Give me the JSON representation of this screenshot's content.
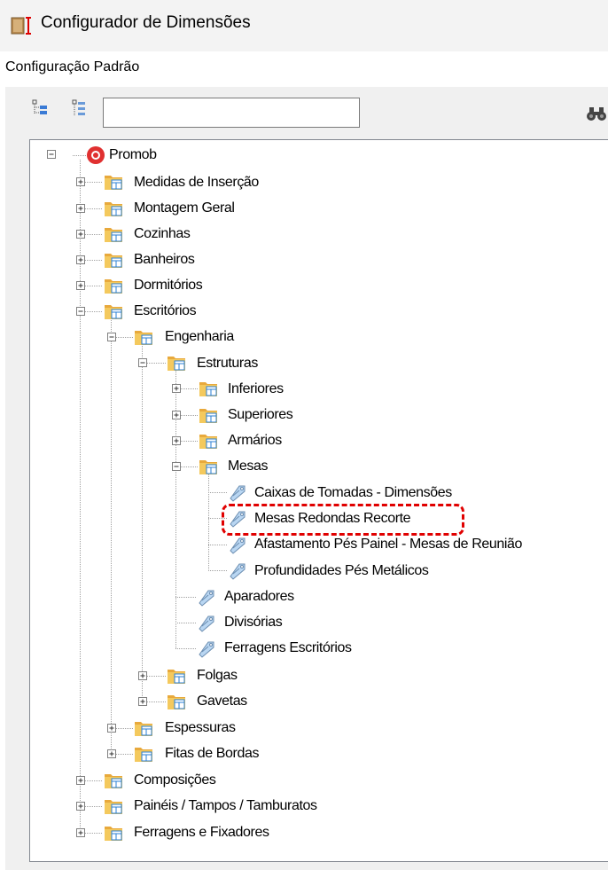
{
  "window": {
    "title": "Configurador de Dimensões",
    "icon": "dimensions-app-icon"
  },
  "section": {
    "label": "Configuração Padrão"
  },
  "toolbar": {
    "search_value": "",
    "buttons": [
      "expand-tree-icon",
      "collapse-tree-icon",
      "binoculars-find-icon"
    ]
  },
  "colors": {
    "highlight": "#e00000",
    "folder": "#e8a93c",
    "tag": "#9ec3e6",
    "root": "#e03030"
  },
  "tree": {
    "root": "Promob",
    "nodes": {
      "medidas_insercao": "Medidas de Inserção",
      "montagem_geral": "Montagem Geral",
      "cozinhas": "Cozinhas",
      "banheiros": "Banheiros",
      "dormitorios": "Dormitórios",
      "escritorios": "Escritórios",
      "engenharia": "Engenharia",
      "estruturas": "Estruturas",
      "inferiores": "Inferiores",
      "superiores": "Superiores",
      "armarios": "Armários",
      "mesas": "Mesas",
      "caixas_tomadas": "Caixas de Tomadas - Dimensões",
      "mesas_redondas": "Mesas Redondas Recorte",
      "afastamento": "Afastamento Pés Painel - Mesas de Reunião",
      "profundidades": "Profundidades Pés Metálicos",
      "aparadores": "Aparadores",
      "divisorias": "Divisórias",
      "ferragens_escritorios": "Ferragens Escritórios",
      "folgas": "Folgas",
      "gavetas": "Gavetas",
      "espessuras": "Espessuras",
      "fitas_bordas": "Fitas de Bordas",
      "composicoes": "Composições",
      "paineis": "Painéis / Tampos / Tamburatos",
      "ferragens_fixadores": "Ferragens e Fixadores"
    },
    "selected": "Mesas Redondas Recorte"
  }
}
